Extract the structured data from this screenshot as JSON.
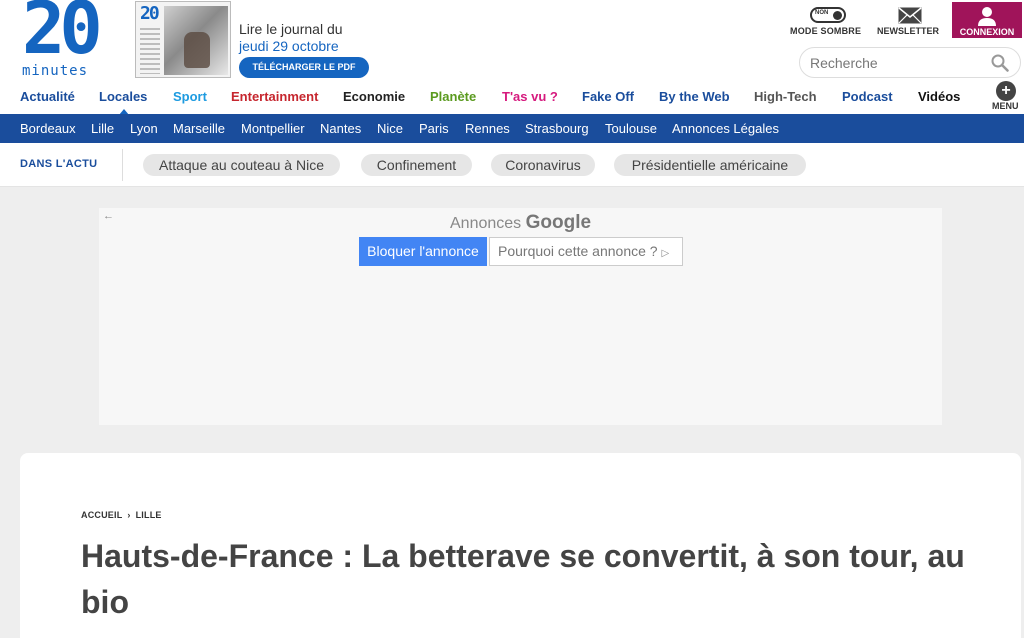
{
  "logo": {
    "number": "20",
    "word": "minutes"
  },
  "journal": {
    "line1": "Lire le journal du",
    "date": "jeudi 29 octobre",
    "pdf_button": "TÉLÉCHARGER LE PDF",
    "thumb_logo": "20"
  },
  "header_actions": {
    "dark_mode_state": "NON",
    "dark_mode_label": "MODE SOMBRE",
    "newsletter_label": "NEWSLETTER",
    "login_label": "CONNEXION"
  },
  "search": {
    "placeholder": "Recherche"
  },
  "main_nav": {
    "items": [
      {
        "label": "Actualité",
        "color": "#1a4d9c"
      },
      {
        "label": "Locales",
        "color": "#1a4d9c"
      },
      {
        "label": "Sport",
        "color": "#1e9be0"
      },
      {
        "label": "Entertainment",
        "color": "#c6262e"
      },
      {
        "label": "Economie",
        "color": "#222222"
      },
      {
        "label": "Planète",
        "color": "#5a9a1e"
      },
      {
        "label": "T'as vu ?",
        "color": "#d61a7e"
      },
      {
        "label": "Fake Off",
        "color": "#1a4d9c"
      },
      {
        "label": "By the Web",
        "color": "#1a4d9c"
      },
      {
        "label": "High-Tech",
        "color": "#555555"
      },
      {
        "label": "Podcast",
        "color": "#1a4d9c"
      },
      {
        "label": "Vidéos",
        "color": "#111111"
      }
    ],
    "menu_label": "MENU",
    "menu_icon": "plus-icon"
  },
  "cities": {
    "items": [
      "Bordeaux",
      "Lille",
      "Lyon",
      "Marseille",
      "Montpellier",
      "Nantes",
      "Nice",
      "Paris",
      "Rennes",
      "Strasbourg",
      "Toulouse",
      "Annonces Légales"
    ]
  },
  "actu": {
    "label": "DANS L'ACTU",
    "tags": [
      "Attaque au couteau à Nice",
      "Confinement",
      "Coronavirus",
      "Présidentielle américaine"
    ]
  },
  "ad": {
    "back_icon": "←",
    "title_prefix": "Annonces",
    "title_brand": "Google",
    "block_button": "Bloquer l'annonce",
    "why_button": "Pourquoi cette annonce ?",
    "why_icon": "▷"
  },
  "article": {
    "breadcrumb": [
      "ACCUEIL",
      "LILLE"
    ],
    "breadcrumb_sep": "›",
    "title": "Hauts-de-France : La betterave se convertit, à son tour, au bio"
  },
  "colors": {
    "brand_blue": "#1565c0",
    "city_bar": "#1a4d9c",
    "login_bg": "#a0145a",
    "ad_button": "#4285f4"
  }
}
